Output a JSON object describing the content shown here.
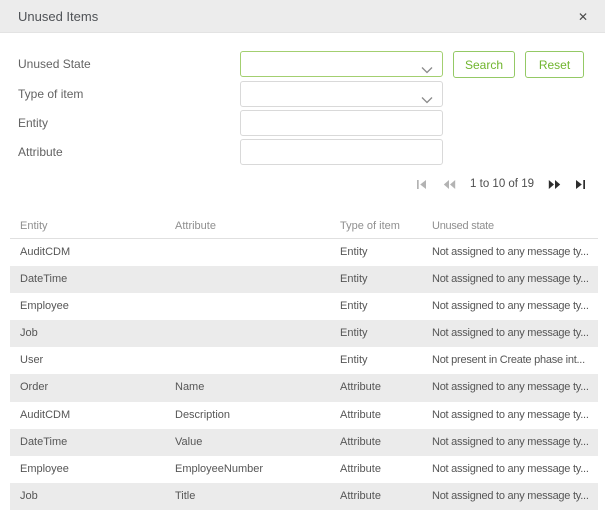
{
  "dialog": {
    "title": "Unused Items",
    "close_glyph": "✕"
  },
  "filters": {
    "unused_state": {
      "label": "Unused State",
      "value": ""
    },
    "type_of_item": {
      "label": "Type of item",
      "value": ""
    },
    "entity": {
      "label": "Entity",
      "value": "",
      "placeholder": ""
    },
    "attribute": {
      "label": "Attribute",
      "value": "",
      "placeholder": ""
    }
  },
  "buttons": {
    "search": "Search",
    "reset": "Reset"
  },
  "pagination": {
    "range_text": "1 to 10 of 19"
  },
  "table": {
    "headers": {
      "entity": "Entity",
      "attribute": "Attribute",
      "type": "Type of item",
      "state": "Unused state"
    },
    "rows": [
      {
        "entity": "AuditCDM",
        "attribute": "",
        "type": "Entity",
        "state": "Not assigned to any message ty..."
      },
      {
        "entity": "DateTime",
        "attribute": "",
        "type": "Entity",
        "state": "Not assigned to any message ty..."
      },
      {
        "entity": "Employee",
        "attribute": "",
        "type": "Entity",
        "state": "Not assigned to any message ty..."
      },
      {
        "entity": "Job",
        "attribute": "",
        "type": "Entity",
        "state": "Not assigned to any message ty..."
      },
      {
        "entity": "User",
        "attribute": "",
        "type": "Entity",
        "state": "Not present in Create phase int..."
      },
      {
        "entity": "Order",
        "attribute": "Name",
        "type": "Attribute",
        "state": "Not assigned to any message ty..."
      },
      {
        "entity": "AuditCDM",
        "attribute": "Description",
        "type": "Attribute",
        "state": "Not assigned to any message ty..."
      },
      {
        "entity": "DateTime",
        "attribute": "Value",
        "type": "Attribute",
        "state": "Not assigned to any message ty..."
      },
      {
        "entity": "Employee",
        "attribute": "EmployeeNumber",
        "type": "Attribute",
        "state": "Not assigned to any message ty..."
      },
      {
        "entity": "Job",
        "attribute": "Title",
        "type": "Attribute",
        "state": "Not assigned to any message ty..."
      }
    ]
  },
  "colors": {
    "accent_green_border": "#94c965",
    "accent_green_text": "#70b52e",
    "focused_field_border": "#a3cf70",
    "header_bg": "#ececec",
    "row_stripe": "#ebebeb"
  }
}
